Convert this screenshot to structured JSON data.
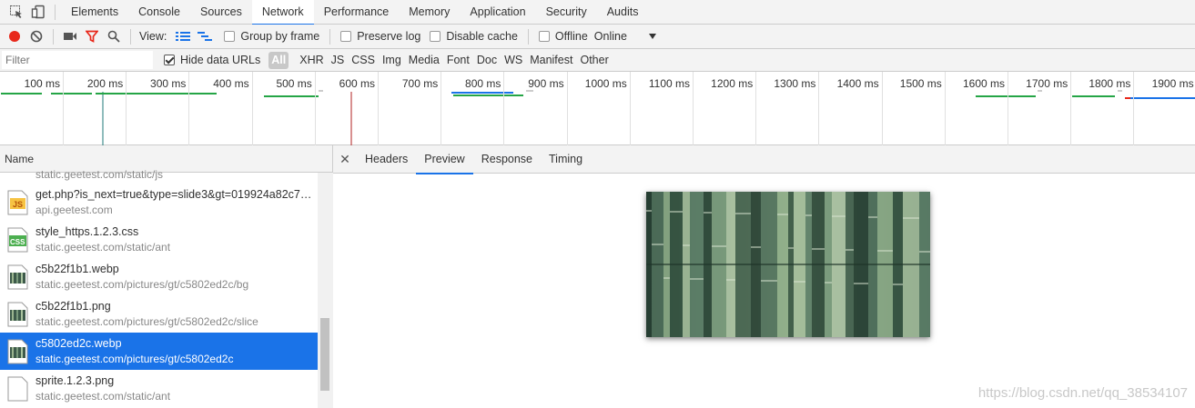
{
  "tabs": [
    "Elements",
    "Console",
    "Sources",
    "Network",
    "Performance",
    "Memory",
    "Application",
    "Security",
    "Audits"
  ],
  "active_tab": "Network",
  "toolbar": {
    "view_label": "View:",
    "group_by_frame": "Group by frame",
    "preserve_log": "Preserve log",
    "disable_cache": "Disable cache",
    "offline": "Offline",
    "throttle": "Online",
    "record_color": "#e8281b"
  },
  "filter": {
    "placeholder": "Filter",
    "hide_data_urls": "Hide data URLs",
    "types": [
      "All",
      "XHR",
      "JS",
      "CSS",
      "Img",
      "Media",
      "Font",
      "Doc",
      "WS",
      "Manifest",
      "Other"
    ]
  },
  "timeline": {
    "ticks": [
      "100 ms",
      "200 ms",
      "300 ms",
      "400 ms",
      "500 ms",
      "600 ms",
      "700 ms",
      "800 ms",
      "900 ms",
      "1000 ms",
      "1100 ms",
      "1200 ms",
      "1300 ms",
      "1400 ms",
      "1500 ms",
      "1600 ms",
      "1700 ms",
      "1800 ms",
      "1900 ms"
    ]
  },
  "list": {
    "header": "Name",
    "partial_top": "static.geetest.com/static/js",
    "rows": [
      {
        "name": "get.php?is_next=true&type=slide3&gt=019924a82c70bb...",
        "path": "api.geetest.com",
        "icon": "js-file-icon"
      },
      {
        "name": "style_https.1.2.3.css",
        "path": "static.geetest.com/static/ant",
        "icon": "css-file-icon"
      },
      {
        "name": "c5b22f1b1.webp",
        "path": "static.geetest.com/pictures/gt/c5802ed2c/bg",
        "icon": "image-file-icon"
      },
      {
        "name": "c5b22f1b1.png",
        "path": "static.geetest.com/pictures/gt/c5802ed2c/slice",
        "icon": "image-file-icon"
      },
      {
        "name": "c5802ed2c.webp",
        "path": "static.geetest.com/pictures/gt/c5802ed2c",
        "icon": "image-file-icon"
      },
      {
        "name": "sprite.1.2.3.png",
        "path": "static.geetest.com/static/ant",
        "icon": "blank-file-icon"
      }
    ],
    "selected_index": 4
  },
  "detail": {
    "tabs": [
      "Headers",
      "Preview",
      "Response",
      "Timing"
    ],
    "active": "Preview"
  },
  "watermark": "https://blog.csdn.net/qq_38534107",
  "colors": {
    "accent": "#1a73e8",
    "bamboo_dark": "#2d4a3a",
    "bamboo_light": "#8fae8a"
  }
}
